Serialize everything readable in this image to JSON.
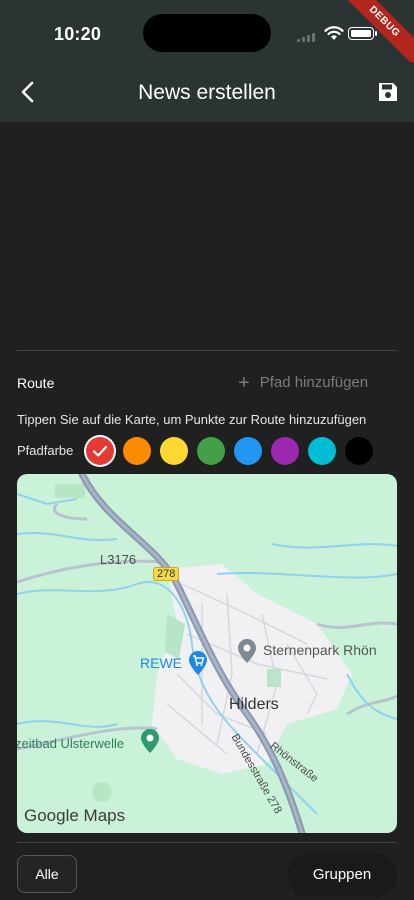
{
  "status": {
    "time": "10:20",
    "debug": "DEBUG"
  },
  "appbar": {
    "title": "News erstellen"
  },
  "route": {
    "label": "Route",
    "add_path": "Pfad hinzufügen",
    "hint": "Tippen Sie auf die Karte, um Punkte zur Route hinzuzufügen",
    "color_label": "Pfadfarbe",
    "colors": [
      "#e53935",
      "#fb8c00",
      "#fdd835",
      "#43a047",
      "#2196f3",
      "#9c27b0",
      "#00bcd4",
      "#000000"
    ],
    "selected_color": "#e53935"
  },
  "map": {
    "road_l3176": "L3176",
    "road_278": "278",
    "poi_rewe": "REWE",
    "poi_sternenpark": "Sternenpark Rhön",
    "town": "Hilders",
    "street_rhoen": "Rhönstraße",
    "street_bund": "Bundesstraße 278",
    "poi_ulster": "zeitbad Ulsterwelle",
    "brand": "Google Maps"
  },
  "filters": {
    "all": "Alle",
    "groups": "Gruppen"
  }
}
